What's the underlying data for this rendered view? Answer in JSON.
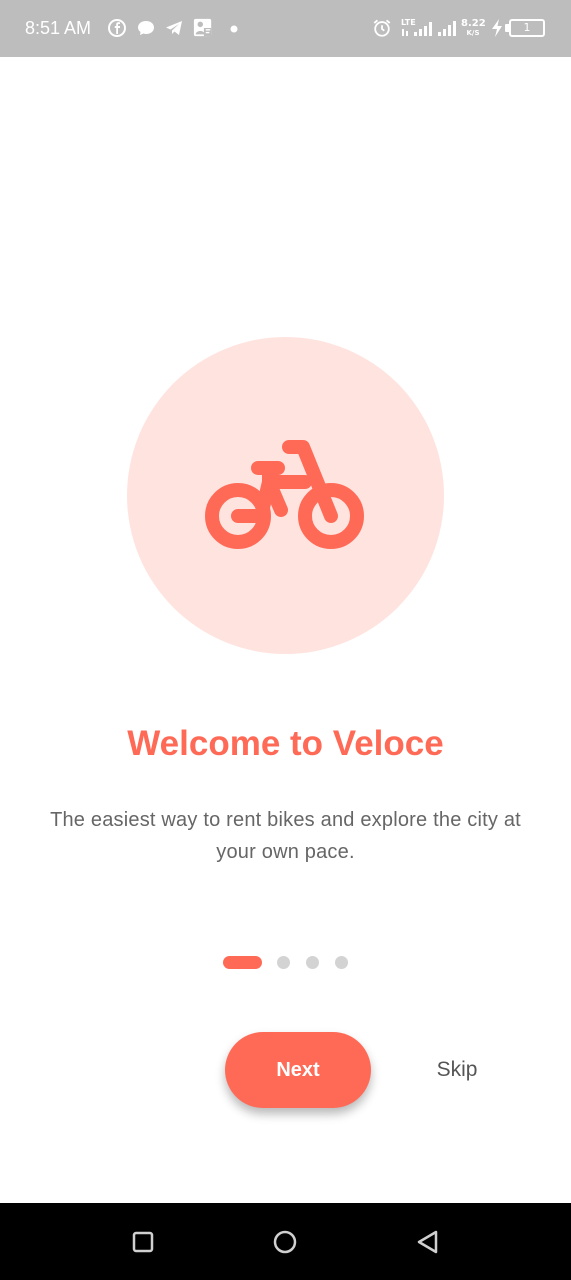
{
  "status_bar": {
    "time": "8:51 AM",
    "network_type": "LTE",
    "network_speed_value": "8.22",
    "network_speed_unit": "K/S",
    "battery_level": "1",
    "icons": [
      "facebook-icon",
      "chat-bubble-icon",
      "telegram-icon",
      "gallery-notification-icon",
      "dot-icon",
      "alarm-icon",
      "lte-signal-icon",
      "signal-icon",
      "charging-icon",
      "battery-icon"
    ]
  },
  "onboarding": {
    "illustration_icon": "bicycle-icon",
    "title": "Welcome to Veloce",
    "subtitle": "The easiest way to rent bikes and explore the city at your own pace.",
    "page_count": 4,
    "current_page": 1,
    "next_label": "Next",
    "skip_label": "Skip"
  },
  "nav_bar": {
    "icons": [
      "recent-apps-icon",
      "home-icon",
      "back-icon"
    ]
  },
  "colors": {
    "accent": "#ff6a57",
    "hero_background": "#ffe3df",
    "status_bar": "#bdbdbd",
    "text_secondary": "#666666",
    "dot_inactive": "#d3d3d3",
    "nav_bar": "#000000"
  }
}
